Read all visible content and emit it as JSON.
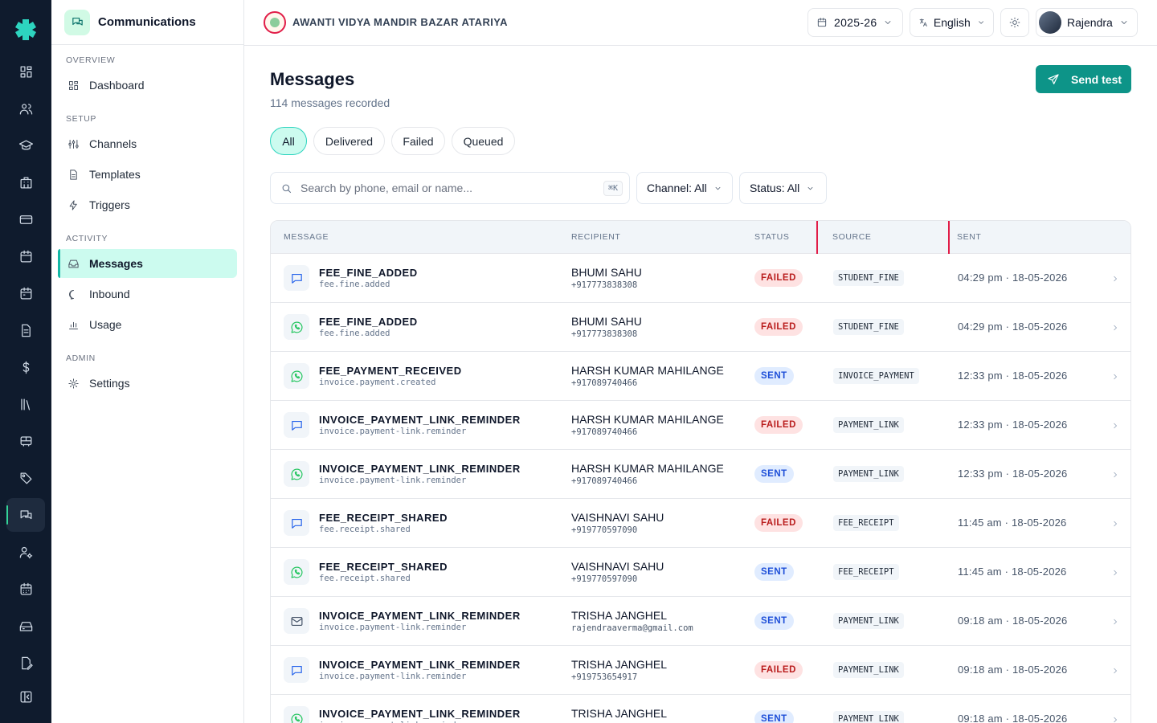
{
  "app": {
    "section_title": "Communications",
    "school_name": "AWANTI VIDYA MANDIR BAZAR ATARIYA"
  },
  "rail": {
    "items": [
      "grid-icon",
      "users-icon",
      "graduation-cap-icon",
      "building-icon",
      "credit-card-icon",
      "calendar-icon",
      "calendar-alt-icon",
      "file-icon",
      "dollar-icon",
      "library-icon",
      "bus-icon",
      "tag-icon",
      "messages-icon",
      "user-cog-icon",
      "calendar-grid-icon",
      "inbox-tray-icon",
      "document-edit-icon",
      "collapse-icon"
    ],
    "active": "messages-icon"
  },
  "sidebar": {
    "sections": [
      {
        "label": "OVERVIEW",
        "items": [
          {
            "label": "Dashboard",
            "icon": "dashboard-icon"
          }
        ]
      },
      {
        "label": "SETUP",
        "items": [
          {
            "label": "Channels",
            "icon": "channels-icon"
          },
          {
            "label": "Templates",
            "icon": "template-icon"
          },
          {
            "label": "Triggers",
            "icon": "lightning-icon"
          }
        ]
      },
      {
        "label": "ACTIVITY",
        "items": [
          {
            "label": "Messages",
            "icon": "inbox-icon",
            "active": true
          },
          {
            "label": "Inbound",
            "icon": "chat-bubble-icon"
          },
          {
            "label": "Usage",
            "icon": "bar-chart-icon"
          }
        ]
      },
      {
        "label": "ADMIN",
        "items": [
          {
            "label": "Settings",
            "icon": "gear-icon"
          }
        ]
      }
    ]
  },
  "topbar": {
    "year": "2025-26",
    "language": "English",
    "user": "Rajendra"
  },
  "main": {
    "title": "Messages",
    "subtitle": "114 messages recorded",
    "send_test_label": "Send test",
    "tabs": [
      "All",
      "Delivered",
      "Failed",
      "Queued"
    ],
    "active_tab": "All",
    "search_placeholder": "Search by phone, email or name...",
    "search_shortcut": "⌘K",
    "channel_filter": "Channel: All",
    "status_filter": "Status: All"
  },
  "table": {
    "columns": [
      "MESSAGE",
      "RECIPIENT",
      "STATUS",
      "SOURCE",
      "SENT"
    ],
    "rows": [
      {
        "channel": "sms",
        "title": "FEE_FINE_ADDED",
        "event": "fee.fine.added",
        "name": "BHUMI SAHU",
        "contact": "+917773838308",
        "status": "FAILED",
        "source": "STUDENT_FINE",
        "sent": "04:29 pm · 18-05-2026"
      },
      {
        "channel": "whatsapp",
        "title": "FEE_FINE_ADDED",
        "event": "fee.fine.added",
        "name": "BHUMI SAHU",
        "contact": "+917773838308",
        "status": "FAILED",
        "source": "STUDENT_FINE",
        "sent": "04:29 pm · 18-05-2026"
      },
      {
        "channel": "whatsapp",
        "title": "FEE_PAYMENT_RECEIVED",
        "event": "invoice.payment.created",
        "name": "HARSH KUMAR MAHILANGE",
        "contact": "+917089740466",
        "status": "SENT",
        "source": "INVOICE_PAYMENT",
        "sent": "12:33 pm · 18-05-2026"
      },
      {
        "channel": "sms",
        "title": "INVOICE_PAYMENT_LINK_REMINDER",
        "event": "invoice.payment-link.reminder",
        "name": "HARSH KUMAR MAHILANGE",
        "contact": "+917089740466",
        "status": "FAILED",
        "source": "PAYMENT_LINK",
        "sent": "12:33 pm · 18-05-2026"
      },
      {
        "channel": "whatsapp",
        "title": "INVOICE_PAYMENT_LINK_REMINDER",
        "event": "invoice.payment-link.reminder",
        "name": "HARSH KUMAR MAHILANGE",
        "contact": "+917089740466",
        "status": "SENT",
        "source": "PAYMENT_LINK",
        "sent": "12:33 pm · 18-05-2026"
      },
      {
        "channel": "sms",
        "title": "FEE_RECEIPT_SHARED",
        "event": "fee.receipt.shared",
        "name": "VAISHNAVI SAHU",
        "contact": "+919770597090",
        "status": "FAILED",
        "source": "FEE_RECEIPT",
        "sent": "11:45 am · 18-05-2026"
      },
      {
        "channel": "whatsapp",
        "title": "FEE_RECEIPT_SHARED",
        "event": "fee.receipt.shared",
        "name": "VAISHNAVI SAHU",
        "contact": "+919770597090",
        "status": "SENT",
        "source": "FEE_RECEIPT",
        "sent": "11:45 am · 18-05-2026"
      },
      {
        "channel": "email",
        "title": "INVOICE_PAYMENT_LINK_REMINDER",
        "event": "invoice.payment-link.reminder",
        "name": "TRISHA JANGHEL",
        "contact": "rajendraaverma@gmail.com",
        "status": "SENT",
        "source": "PAYMENT_LINK",
        "sent": "09:18 am · 18-05-2026"
      },
      {
        "channel": "sms",
        "title": "INVOICE_PAYMENT_LINK_REMINDER",
        "event": "invoice.payment-link.reminder",
        "name": "TRISHA JANGHEL",
        "contact": "+919753654917",
        "status": "FAILED",
        "source": "PAYMENT_LINK",
        "sent": "09:18 am · 18-05-2026"
      },
      {
        "channel": "whatsapp",
        "title": "INVOICE_PAYMENT_LINK_REMINDER",
        "event": "invoice.payment-link.reminder",
        "name": "TRISHA JANGHEL",
        "contact": "",
        "status": "SENT",
        "source": "PAYMENT_LINK",
        "sent": "09:18 am · 18-05-2026"
      }
    ]
  },
  "colors": {
    "rail_bg": "#0f1b2d",
    "accent": "#0d9488",
    "failed": "#b91c1c",
    "sent": "#1d4ed8",
    "whatsapp": "#22c55e",
    "sms": "#2563eb",
    "highlight": "#e11d48"
  }
}
